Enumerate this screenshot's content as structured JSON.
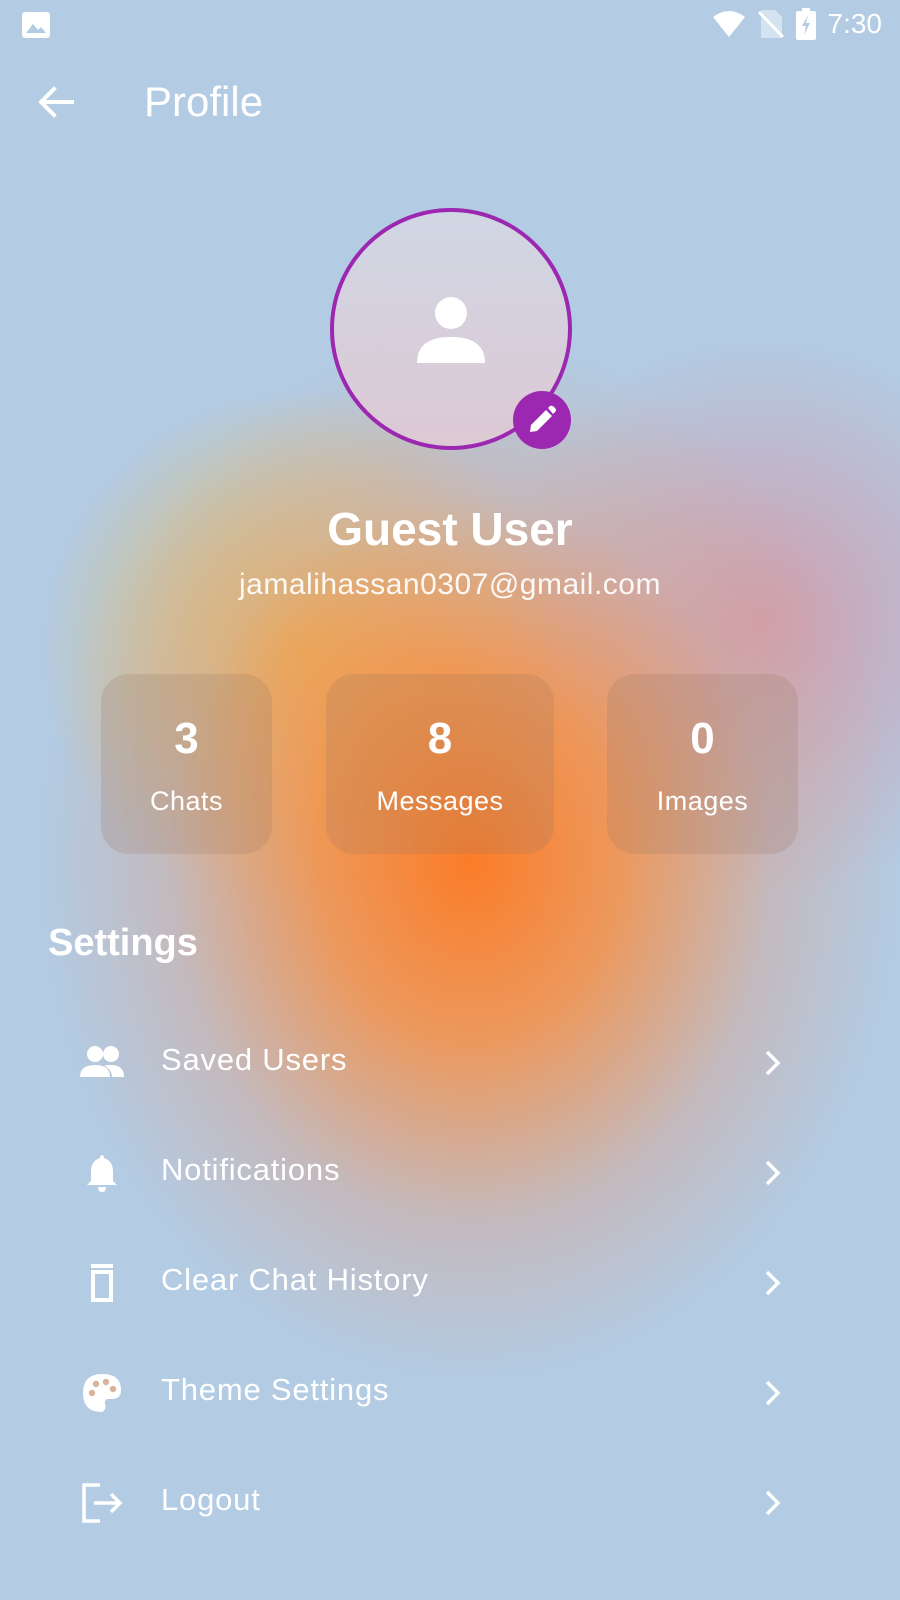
{
  "status_bar": {
    "time": "7:30",
    "icons": [
      "image-icon",
      "wifi-icon",
      "no-sim-icon",
      "battery-charging-icon"
    ]
  },
  "app_bar": {
    "title": "Profile",
    "back_icon": "arrow-left-icon"
  },
  "profile": {
    "name": "Guest User",
    "email": "jamalihassan0307@gmail.com",
    "avatar_icon": "person-icon",
    "edit_icon": "pencil-icon",
    "accent_color": "#9c27b0"
  },
  "stats": [
    {
      "value": "3",
      "label": "Chats"
    },
    {
      "value": "8",
      "label": "Messages"
    },
    {
      "value": "0",
      "label": "Images"
    }
  ],
  "settings": {
    "title": "Settings",
    "items": [
      {
        "label": "Saved Users",
        "icon": "people-icon"
      },
      {
        "label": "Notifications",
        "icon": "bell-icon"
      },
      {
        "label": "Clear Chat History",
        "icon": "trash-icon"
      },
      {
        "label": "Theme Settings",
        "icon": "palette-icon"
      },
      {
        "label": "Logout",
        "icon": "logout-icon"
      }
    ]
  }
}
